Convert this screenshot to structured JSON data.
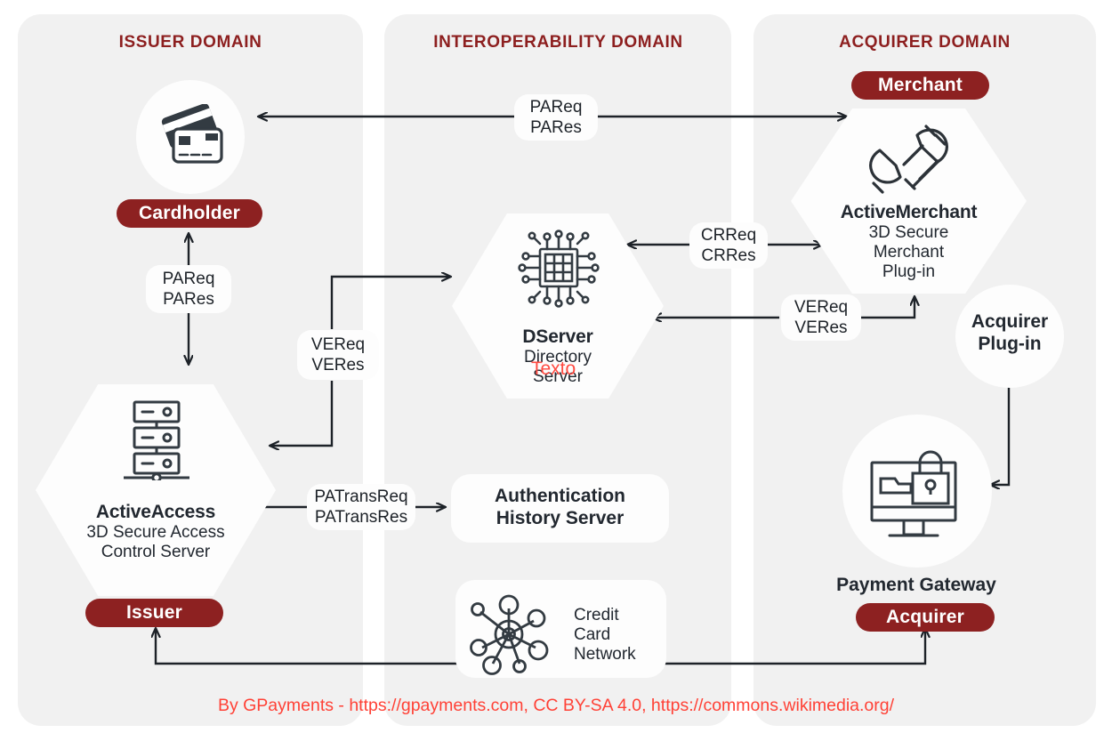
{
  "domains": [
    {
      "id": "issuer",
      "title": "ISSUER DOMAIN"
    },
    {
      "id": "interoperability",
      "title": "INTEROPERABILITY DOMAIN"
    },
    {
      "id": "acquirer",
      "title": "ACQUIRER DOMAIN"
    }
  ],
  "nodes": {
    "cardholder": {
      "badge": "Cardholder",
      "icon": "credit-cards-icon"
    },
    "active_access": {
      "title": "ActiveAccess",
      "subtitle_line1": "3D Secure Access",
      "subtitle_line2": "Control Server",
      "badge": "Issuer",
      "icon": "server-rack-icon"
    },
    "dserver": {
      "title": "DServer",
      "subtitle_line1": "Directory",
      "subtitle_line2": "Server",
      "overlay_text": "Texto",
      "icon": "chip-icon"
    },
    "auth_history": {
      "line1": "Authentication",
      "line2": "History Server"
    },
    "credit_card_network": {
      "line1": "Credit",
      "line2": "Card",
      "line3": "Network",
      "icon": "network-hub-icon"
    },
    "active_merchant": {
      "badge": "Merchant",
      "title": "ActiveMerchant",
      "subtitle_line1": "3D Secure",
      "subtitle_line2": "Merchant",
      "subtitle_line3": "Plug-in",
      "icon": "plug-icon"
    },
    "acquirer_plugin": {
      "line1": "Acquirer",
      "line2": "Plug-in"
    },
    "payment_gateway": {
      "title": "Payment Gateway",
      "badge": "Acquirer",
      "icon": "secure-payment-monitor-icon"
    }
  },
  "messages": {
    "pareq_pares_top": {
      "line1": "PAReq",
      "line2": "PARes"
    },
    "pareq_pares_left": {
      "line1": "PAReq",
      "line2": "PARes"
    },
    "vereq_veres_left": {
      "line1": "VEReq",
      "line2": "VERes"
    },
    "crreq_crres": {
      "line1": "CRReq",
      "line2": "CRRes"
    },
    "vereq_veres_right": {
      "line1": "VEReq",
      "line2": "VERes"
    },
    "patransreq_patransres": {
      "line1": "PATransReq",
      "line2": "PATransRes"
    }
  },
  "attribution": "By GPayments - https://gpayments.com, CC BY-SA 4.0, https://commons.wikimedia.org/",
  "colors": {
    "brand_red": "#8d2121",
    "title_red": "#8d1f1f",
    "attribution_red": "#ff4136",
    "column_bg": "#f1f1f1",
    "node_bg": "#fdfdfd",
    "ink": "#222830"
  }
}
